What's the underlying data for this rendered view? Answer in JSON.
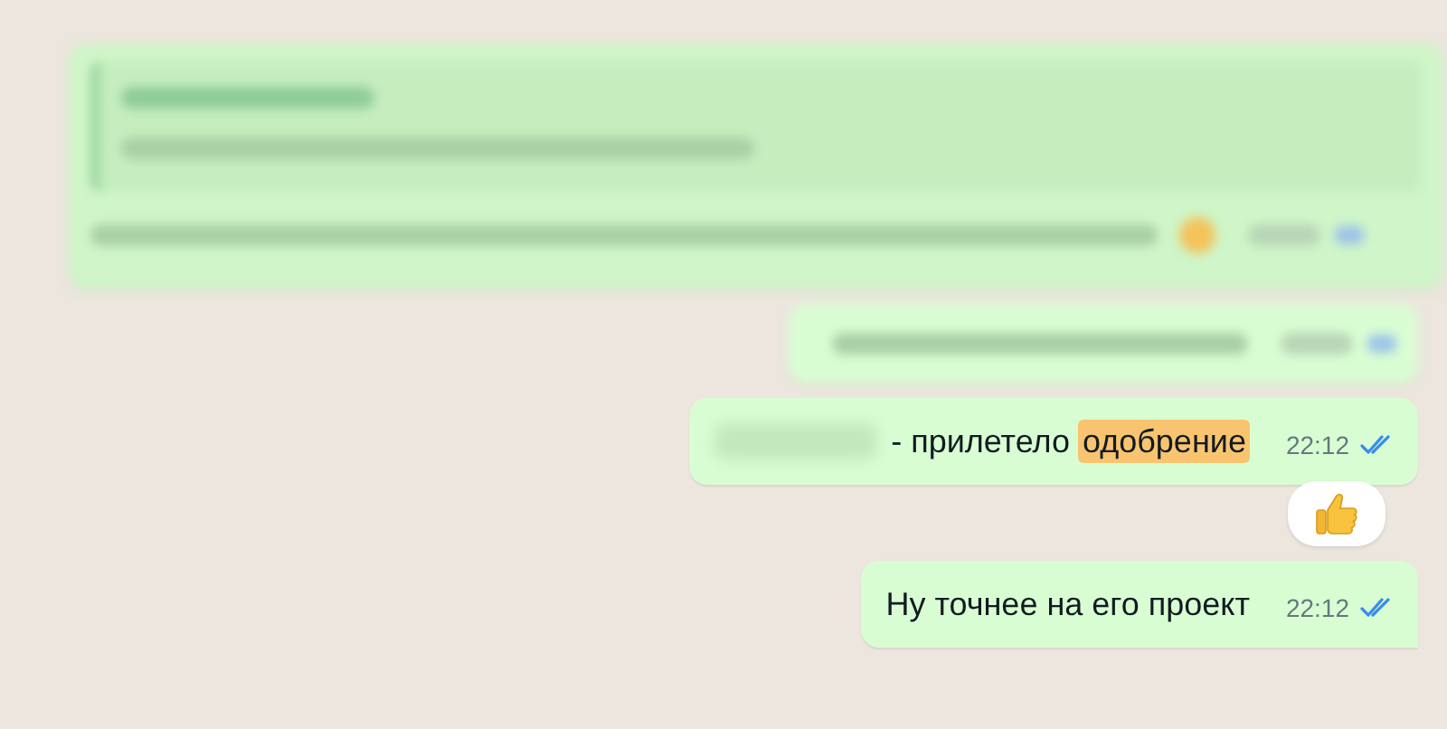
{
  "messages": [
    {
      "kind": "blurred",
      "quoted": true,
      "emoji": true,
      "read": true
    },
    {
      "kind": "blurred",
      "quoted": false,
      "emoji": false,
      "read": true
    },
    {
      "kind": "text",
      "parts": [
        {
          "kind": "blurred"
        },
        {
          "kind": "text",
          "text": "- прилетело"
        },
        {
          "kind": "highlight",
          "text": "одобрение"
        }
      ],
      "time": "22:12",
      "read": true,
      "reacted": true,
      "tail": false
    },
    {
      "kind": "text",
      "parts": [
        {
          "kind": "text",
          "text": "Ну точнее на его проект"
        }
      ],
      "time": "22:12",
      "read": true,
      "reacted": false,
      "tail": true
    }
  ]
}
